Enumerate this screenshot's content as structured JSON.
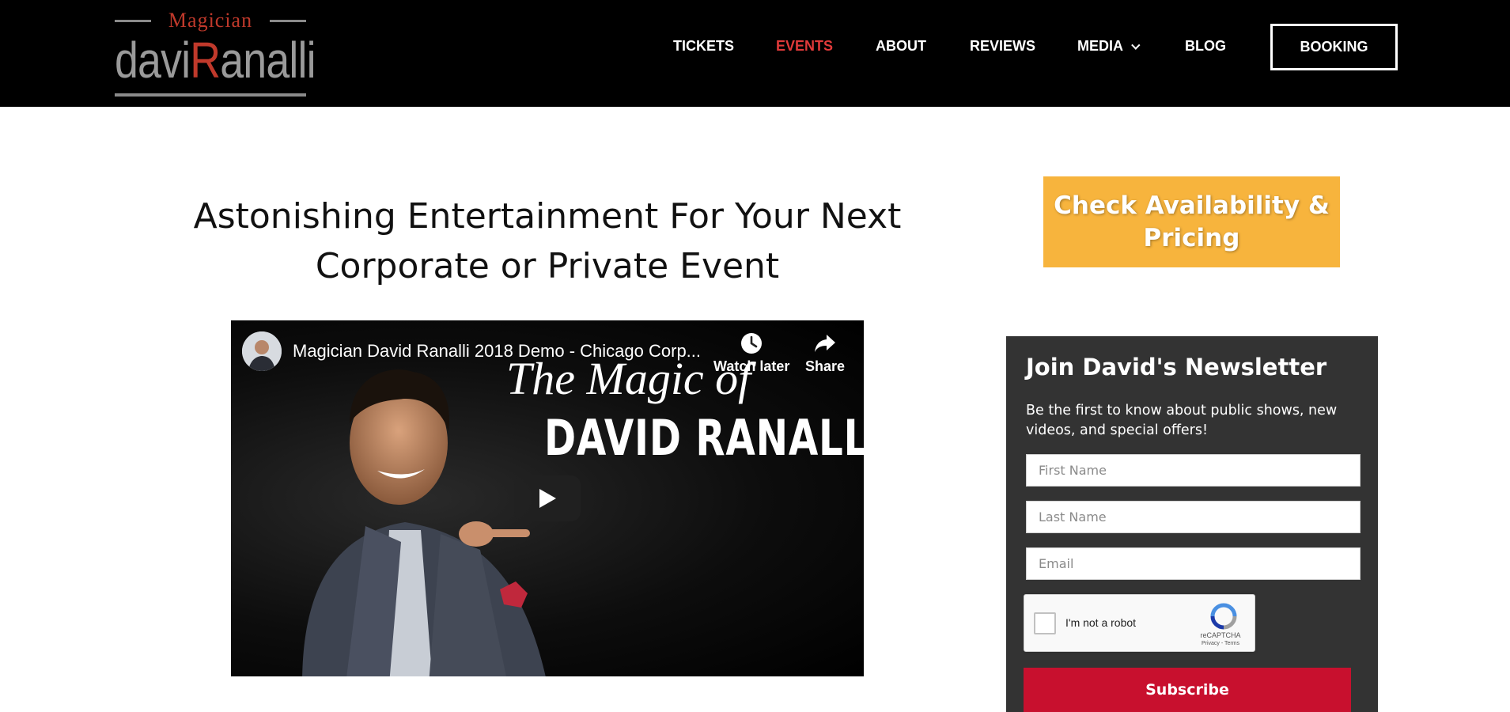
{
  "logo": {
    "top_text": "Magician",
    "name_part1": "davi",
    "name_accent": "R",
    "name_part2": "analli"
  },
  "nav": {
    "items": [
      {
        "label": "TICKETS"
      },
      {
        "label": "EVENTS",
        "active": true
      },
      {
        "label": "ABOUT"
      },
      {
        "label": "REVIEWS"
      },
      {
        "label": "MEDIA",
        "has_dropdown": true
      },
      {
        "label": "BLOG"
      }
    ],
    "booking_label": "BOOKING"
  },
  "main": {
    "headline_line1": "Astonishing Entertainment For Your Next",
    "headline_line2": "Corporate or Private Event"
  },
  "video": {
    "title": "Magician David Ranalli 2018 Demo - Chicago Corp...",
    "watch_later_label": "Watch later",
    "share_label": "Share",
    "overlay_script": "The Magic of",
    "overlay_name": "DAVID RANALLI"
  },
  "cta": {
    "line1": "Check Availability &",
    "line2": "Pricing"
  },
  "newsletter": {
    "title": "Join David's Newsletter",
    "description": "Be the first to know about public shows, new videos, and special offers!",
    "first_name_placeholder": "First Name",
    "last_name_placeholder": "Last Name",
    "email_placeholder": "Email",
    "captcha_label": "I'm not a robot",
    "captcha_brand": "reCAPTCHA",
    "captcha_links": "Privacy - Terms",
    "subscribe_label": "Subscribe"
  },
  "colors": {
    "header_bg": "#000000",
    "accent_red": "#e03a3a",
    "cta_orange": "#f7b43d",
    "newsletter_bg": "#333333",
    "subscribe_red": "#c8102e"
  }
}
